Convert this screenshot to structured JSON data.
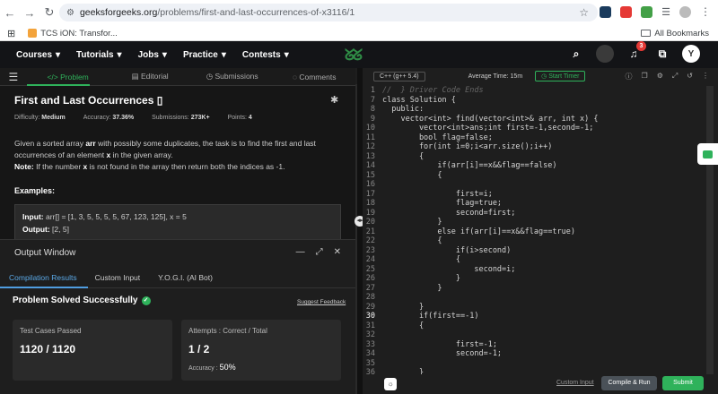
{
  "browser": {
    "url_domain": "geeksforgeeks.org",
    "url_path": "/problems/first-and-last-occurrences-of-x3116/1",
    "bookmark": "TCS iON: Transfor...",
    "all_bookmarks": "All Bookmarks"
  },
  "header": {
    "nav": [
      "Courses",
      "Tutorials",
      "Jobs",
      "Practice",
      "Contests"
    ],
    "logo": "GfG",
    "notification_count": "3",
    "avatar_initial": "Y"
  },
  "left_tabs": [
    "Problem",
    "Editorial",
    "Submissions",
    "Comments"
  ],
  "problem": {
    "title": "First and Last Occurrences",
    "difficulty_label": "Difficulty:",
    "difficulty": "Medium",
    "accuracy_label": "Accuracy:",
    "accuracy": "37.36%",
    "submissions_label": "Submissions:",
    "submissions": "273K+",
    "points_label": "Points:",
    "points": "4",
    "desc_1": "Given a sorted array ",
    "desc_arr": "arr",
    "desc_2": " with possibly some duplicates, the task is to find the first and last occurrences of an element ",
    "desc_x": "x",
    "desc_3": " in the given array.",
    "note_label": "Note:",
    "note_1": " If the number ",
    "note_x": "x",
    "note_2": " is not found in the array then return both the indices as -1.",
    "examples_label": "Examples:",
    "input_label": "Input:",
    "input_value": " arr[] = [1, 3, 5, 5, 5, 5, 67, 123, 125], x = 5",
    "output_label": "Output:",
    "output_value": "  [2, 5]"
  },
  "output_window": {
    "title": "Output Window",
    "tabs": [
      "Compilation Results",
      "Custom Input",
      "Y.O.G.I. (AI Bot)"
    ],
    "status": "Problem Solved Successfully",
    "feedback": "Suggest Feedback",
    "tests_label": "Test Cases Passed",
    "tests_value": "1120 / 1120",
    "attempts_label": "Attempts : Correct / Total",
    "attempts_value": "1 / 2",
    "accuracy_label": "Accuracy :",
    "accuracy_value": "50%"
  },
  "editor": {
    "language": "C++ (g++ 5.4)",
    "avg_time": "Average Time: 15m",
    "timer": "Start Timer",
    "lines": [
      {
        "n": "1",
        "t": "//  } Driver Code Ends",
        "c": "cm"
      },
      {
        "n": "7",
        "t": "class Solution {",
        "c": "ct"
      },
      {
        "n": "8",
        "t": "  public:",
        "c": "ct"
      },
      {
        "n": "9",
        "t": "    vector<int> find(vector<int>& arr, int x) {",
        "c": "ct"
      },
      {
        "n": "10",
        "t": "        vector<int>ans;int first=-1,second=-1;",
        "c": "ct"
      },
      {
        "n": "11",
        "t": "        bool flag=false;",
        "c": "ct"
      },
      {
        "n": "12",
        "t": "        for(int i=0;i<arr.size();i++)",
        "c": "ct"
      },
      {
        "n": "13",
        "t": "        {",
        "c": "ct"
      },
      {
        "n": "14",
        "t": "            if(arr[i]==x&&flag==false)",
        "c": "ct"
      },
      {
        "n": "15",
        "t": "            {",
        "c": "ct"
      },
      {
        "n": "16",
        "t": "",
        "c": "ct"
      },
      {
        "n": "17",
        "t": "                first=i;",
        "c": "ct"
      },
      {
        "n": "18",
        "t": "                flag=true;",
        "c": "ct"
      },
      {
        "n": "19",
        "t": "                second=first;",
        "c": "ct"
      },
      {
        "n": "20",
        "t": "            }",
        "c": "ct"
      },
      {
        "n": "21",
        "t": "            else if(arr[i]==x&&flag==true)",
        "c": "ct"
      },
      {
        "n": "22",
        "t": "            {",
        "c": "ct"
      },
      {
        "n": "23",
        "t": "                if(i>second)",
        "c": "ct"
      },
      {
        "n": "24",
        "t": "                {",
        "c": "ct"
      },
      {
        "n": "25",
        "t": "                    second=i;",
        "c": "ct"
      },
      {
        "n": "26",
        "t": "                }",
        "c": "ct"
      },
      {
        "n": "27",
        "t": "            }",
        "c": "ct"
      },
      {
        "n": "28",
        "t": "",
        "c": "ct"
      },
      {
        "n": "29",
        "t": "        }",
        "c": "ct"
      },
      {
        "n": "30",
        "t": "        if(first==-1)",
        "c": "ct",
        "cur": true
      },
      {
        "n": "31",
        "t": "        {",
        "c": "ct"
      },
      {
        "n": "32",
        "t": "",
        "c": "ct"
      },
      {
        "n": "33",
        "t": "                first=-1;",
        "c": "ct"
      },
      {
        "n": "34",
        "t": "                second=-1;",
        "c": "ct"
      },
      {
        "n": "35",
        "t": "",
        "c": "ct"
      },
      {
        "n": "36",
        "t": "        }",
        "c": "ct"
      }
    ],
    "custom_input": "Custom Input",
    "run_label": "Compile & Run",
    "submit_label": "Submit"
  }
}
